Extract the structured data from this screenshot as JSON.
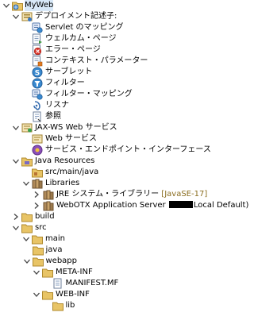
{
  "tree": {
    "root": {
      "label": "MyWeb"
    },
    "deployment_descriptor": {
      "label": "デプロイメント記述子:",
      "children": {
        "servlet_mapping": "Servlet のマッピング",
        "welcome_page": "ウェルカム・ページ",
        "error_page": "エラー・ページ",
        "context_params": "コンテキスト・パラメーター",
        "servlet": "サーブレット",
        "filter": "フィルター",
        "filter_mapping": "フィルター・マッピング",
        "listener": "リスナ",
        "reference": "参照"
      }
    },
    "jaxws": {
      "label": "JAX-WS Web サービス",
      "children": {
        "web_service": "Web サービス",
        "sei": "サービス・エンドポイント・インターフェース"
      }
    },
    "java_resources": {
      "label": "Java Resources",
      "src_main_java": "src/main/java",
      "libraries": {
        "label": "Libraries",
        "jre": {
          "label": "JRE システム・ライブラリー",
          "decoration": "[JavaSE-17]"
        },
        "webotx": {
          "label_start": "WebOTX Application Server",
          "label_end": "Local Default)"
        }
      }
    },
    "build": "build",
    "src": {
      "label": "src",
      "main": "main",
      "java": "java",
      "webapp": "webapp",
      "meta_inf": "META-INF",
      "manifest": "MANIFEST.MF",
      "web_inf": "WEB-INF",
      "lib": "lib"
    }
  }
}
